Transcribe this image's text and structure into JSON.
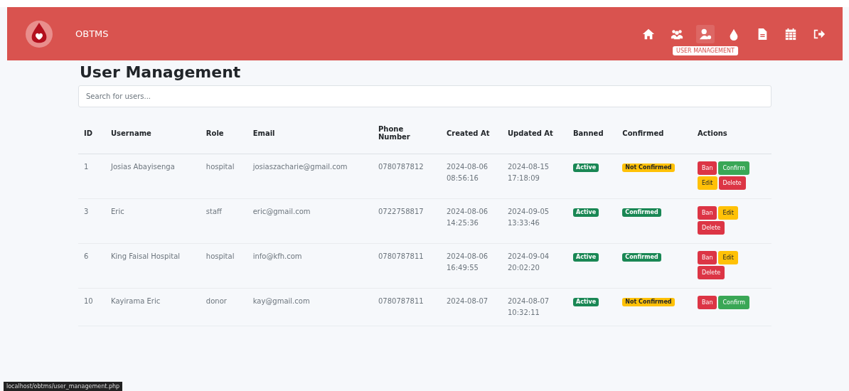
{
  "navbar": {
    "brand": "OBTMS",
    "icons": [
      {
        "kind": "home",
        "selected": false
      },
      {
        "kind": "users",
        "selected": false
      },
      {
        "kind": "user-gear",
        "selected": true
      },
      {
        "kind": "drop",
        "selected": false
      },
      {
        "kind": "file",
        "selected": false
      },
      {
        "kind": "calendar",
        "selected": false
      },
      {
        "kind": "logout",
        "selected": false
      }
    ],
    "tooltip": "USER MANAGEMENT"
  },
  "title": "User Management",
  "search": {
    "placeholder": "Search for users..."
  },
  "table": {
    "columns": [
      "ID",
      "Username",
      "Role",
      "Email",
      "Phone Number",
      "Created At",
      "Updated At",
      "Banned",
      "Confirmed",
      "Actions"
    ],
    "rows": [
      {
        "id": "1",
        "username": "Josias Abayisenga",
        "role": "hospital",
        "email": "josiaszacharie@gmail.com",
        "phone": "0780787812",
        "created": "2024-08-06 08:56:16",
        "updated": "2024-08-15 17:18:09",
        "banned": {
          "kind": "active",
          "label": "Active"
        },
        "confirmed": {
          "kind": "pending",
          "label": "Not Confirmed"
        },
        "actions": [
          {
            "kind": "danger",
            "label": "Ban"
          },
          {
            "kind": "success",
            "label": "Confirm"
          },
          {
            "kind": "warning",
            "label": "Edit"
          },
          {
            "kind": "danger",
            "label": "Delete"
          }
        ]
      },
      {
        "id": "3",
        "username": "Eric",
        "role": "staff",
        "email": "eric@gmail.com",
        "phone": "0722758817",
        "created": "2024-08-06 14:25:36",
        "updated": "2024-09-05 13:33:46",
        "banned": {
          "kind": "active",
          "label": "Active"
        },
        "confirmed": {
          "kind": "done",
          "label": "Confirmed"
        },
        "actions": [
          {
            "kind": "danger",
            "label": "Ban"
          },
          {
            "kind": "warning",
            "label": "Edit"
          },
          {
            "kind": "danger",
            "label": "Delete"
          }
        ]
      },
      {
        "id": "6",
        "username": "King Faisal Hospital",
        "role": "hospital",
        "email": "info@kfh.com",
        "phone": "0780787811",
        "created": "2024-08-06 16:49:55",
        "updated": "2024-09-04 20:02:20",
        "banned": {
          "kind": "active",
          "label": "Active"
        },
        "confirmed": {
          "kind": "done",
          "label": "Confirmed"
        },
        "actions": [
          {
            "kind": "danger",
            "label": "Ban"
          },
          {
            "kind": "warning",
            "label": "Edit"
          },
          {
            "kind": "danger",
            "label": "Delete"
          }
        ]
      },
      {
        "id": "10",
        "username": "Kayirama Eric",
        "role": "donor",
        "email": "kay@gmail.com",
        "phone": "0780787811",
        "created": "2024-08-07",
        "updated": "2024-08-07 10:32:11",
        "banned": {
          "kind": "active",
          "label": "Active"
        },
        "confirmed": {
          "kind": "pending",
          "label": "Not Confirmed"
        },
        "actions": [
          {
            "kind": "danger",
            "label": "Ban"
          },
          {
            "kind": "success",
            "label": "Confirm"
          }
        ]
      }
    ]
  },
  "status_bar": {
    "url": "localhost/obtms/user_management.php"
  }
}
